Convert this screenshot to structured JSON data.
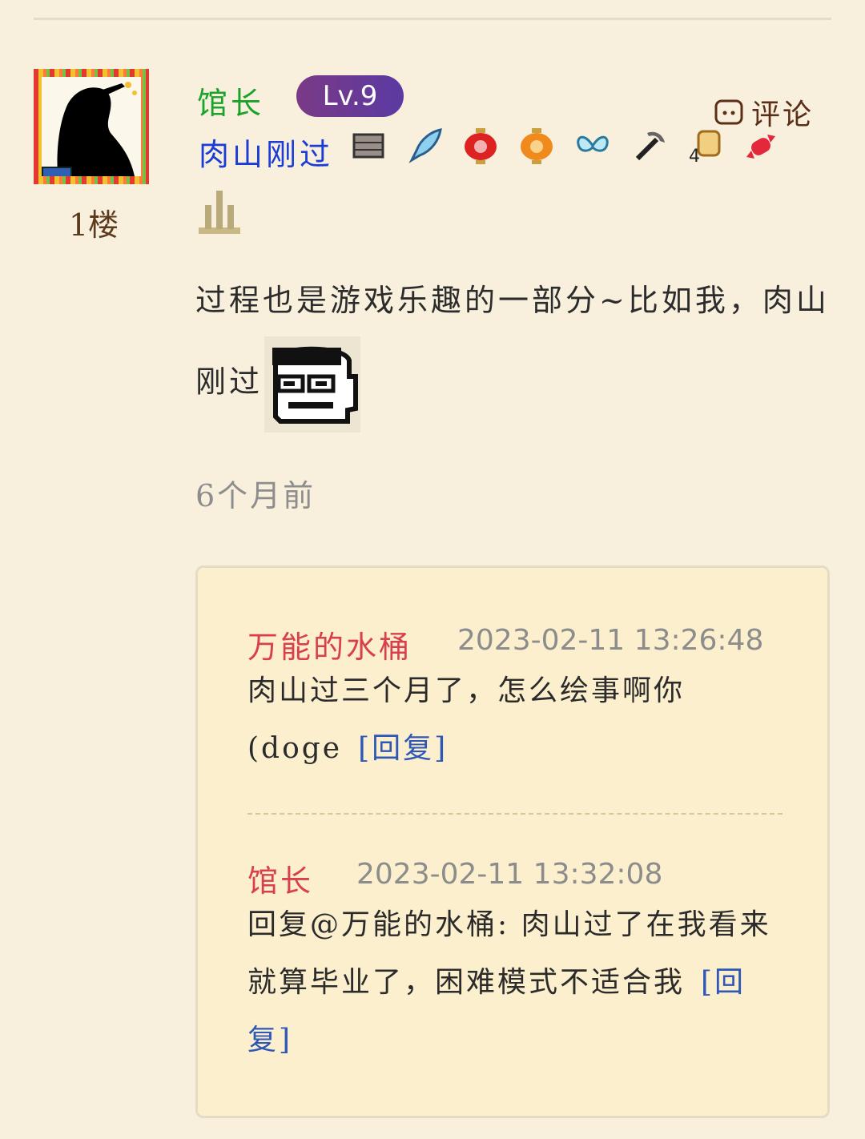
{
  "post": {
    "floor": "1楼",
    "author": "馆长",
    "level": "Lv.9",
    "title": "肉山刚过",
    "comment_label": "评论",
    "text": "过程也是游戏乐趣的一部分~比如我，肉山刚过",
    "time": "6个月前",
    "badges": [
      "brick-badge-icon",
      "feather-badge-icon",
      "red-lantern-badge-icon",
      "orange-lantern-badge-icon",
      "butterfly-badge-icon",
      "pickaxe-badge-icon",
      "number-4-badge-icon",
      "candy-badge-icon",
      "castle-badge-icon"
    ],
    "emoji_icon": "glasses-face-emoji-icon",
    "colors": {
      "author": "#1aa22a",
      "title": "#1b3cd7",
      "reply_author": "#d8404f",
      "reply_link": "#2d58b8",
      "background": "#f8f0dd",
      "reply_box": "#fcefcd"
    }
  },
  "replies": [
    {
      "author": "万能的水桶",
      "time": "2023-02-11 13:26:48",
      "text": "肉山过三个月了，怎么绘事啊你(doge",
      "reply_label": "[回复]"
    },
    {
      "author": "馆长",
      "time": "2023-02-11 13:32:08",
      "text": "回复@万能的水桶: 肉山过了在我看来就算毕业了，困难模式不适合我",
      "reply_label": "[回复]"
    }
  ]
}
